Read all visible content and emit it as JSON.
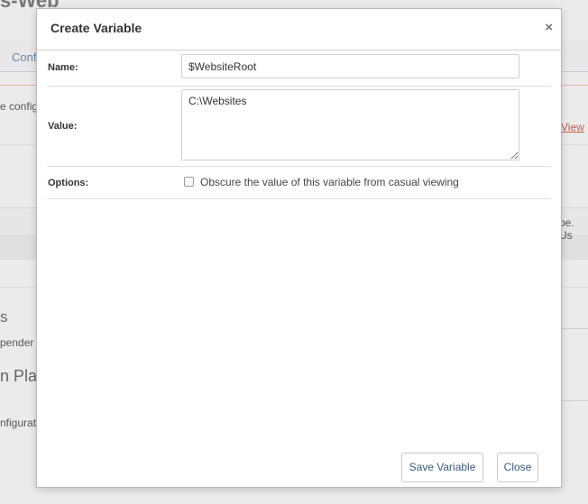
{
  "background": {
    "title_fragment": "s-Web",
    "tab_fragment": "Conf",
    "text_fragment_1": "e config",
    "link_fragment": "View",
    "text_fragment_2": "pe. Us",
    "heading_fragment_1": "s",
    "text_fragment_3": "pender",
    "heading_fragment_2": "n Plar",
    "text_fragment_4": "nfigurat"
  },
  "modal": {
    "title": "Create Variable",
    "close_glyph": "×",
    "fields": {
      "name_label": "Name:",
      "name_value": "$WebsiteRoot",
      "value_label": "Value:",
      "value_value": "C:\\Websites",
      "options_label": "Options:",
      "obscure_label": "Obscure the value of this variable from casual viewing",
      "obscure_checked": false
    },
    "buttons": {
      "save": "Save Variable",
      "close": "Close"
    }
  }
}
